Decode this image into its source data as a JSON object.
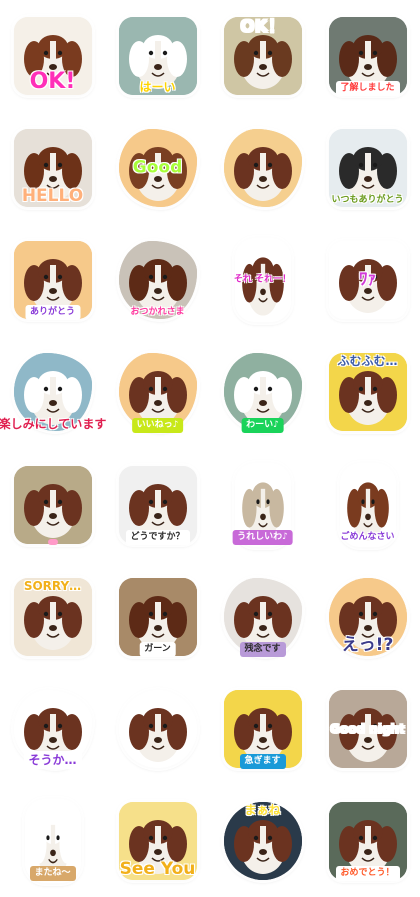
{
  "stickers": [
    {
      "id": "ok-1",
      "caption": "OK!",
      "bg": "#f5f0e8",
      "fur": "#7a3b1f",
      "text_color": "#ff2fb8",
      "label_bg": "",
      "size": "xl",
      "pos": "bottom",
      "shape": "box"
    },
    {
      "id": "ha-i",
      "caption": "はーい",
      "bg": "#9ab7b0",
      "fur": "#ffffff",
      "text_color": "#ffd400",
      "label_bg": "",
      "size": "m",
      "pos": "bottom",
      "shape": "box"
    },
    {
      "id": "ok-2",
      "caption": "OK！",
      "bg": "#cfc6a4",
      "fur": "#6a3a20",
      "text_color": "#ffffff",
      "label_bg": "",
      "size": "l",
      "pos": "top",
      "shape": "box"
    },
    {
      "id": "ryoukai",
      "caption": "了解しました",
      "bg": "#6f7a72",
      "fur": "#5a2a18",
      "text_color": "#ff3a3a",
      "label_bg": "#ffffff",
      "size": "s",
      "pos": "bottom",
      "shape": "box"
    },
    {
      "id": "hello",
      "caption": "HELLO",
      "bg": "#e6e0d8",
      "fur": "#6d3218",
      "text_color": "#ffb07a",
      "label_bg": "",
      "size": "l",
      "pos": "bottom",
      "shape": "box"
    },
    {
      "id": "good",
      "caption": "Good",
      "bg": "#f6c98a",
      "fur": "#7a3f22",
      "text_color": "#a8ff3a",
      "label_bg": "",
      "size": "l",
      "pos": "mid",
      "shape": "blob"
    },
    {
      "id": "dogs-pair",
      "caption": "",
      "bg": "#f5cf8f",
      "fur": "#6b3320",
      "text_color": "#000000",
      "label_bg": "",
      "size": "m",
      "pos": "bottom",
      "shape": "blob"
    },
    {
      "id": "itsumo-arigatou",
      "caption": "いつもありがとう",
      "bg": "#e6ecef",
      "fur": "#2a2a2a",
      "text_color": "#6a9a1a",
      "label_bg": "",
      "size": "s",
      "pos": "bottom",
      "shape": "box"
    },
    {
      "id": "arigatou",
      "caption": "ありがとう",
      "bg": "#f6c98a",
      "fur": "#6b3320",
      "text_color": "#8a3bd8",
      "label_bg": "#ffffff",
      "size": "s",
      "pos": "bottom",
      "shape": "box"
    },
    {
      "id": "otsukaresama",
      "caption": "おつかれさま",
      "bg": "#c9c2b8",
      "fur": "#5d2a16",
      "text_color": "#ff3aa0",
      "label_bg": "",
      "size": "s",
      "pos": "bottom",
      "shape": "blob"
    },
    {
      "id": "sore-sore",
      "caption": "それ それー！",
      "bg": "#ffffff",
      "fur": "#6b3320",
      "text_color": "#e026c8",
      "label_bg": "",
      "size": "s",
      "pos": "mid",
      "shape": "tall"
    },
    {
      "id": "waa",
      "caption": "ﾜｧ",
      "bg": "#ffffff",
      "fur": "#6b3320",
      "text_color": "#d23bd8",
      "label_bg": "",
      "size": "l",
      "pos": "mid",
      "shape": "box"
    },
    {
      "id": "tanoshimi",
      "caption": "楽しみにしています",
      "bg": "#8fb8c8",
      "fur": "#ffffff",
      "text_color": "#e02050",
      "label_bg": "",
      "size": "m",
      "pos": "bottom",
      "shape": "blob"
    },
    {
      "id": "iine",
      "caption": "いいねっ♪",
      "bg": "#f6c98a",
      "fur": "#6b3320",
      "text_color": "#ffffff",
      "label_bg": "#c8e81a",
      "size": "s",
      "pos": "bottom",
      "shape": "blob"
    },
    {
      "id": "waai",
      "caption": "わーい♪",
      "bg": "#8fb0a0",
      "fur": "#ffffff",
      "text_color": "#ffffff",
      "label_bg": "#1ad35a",
      "size": "s",
      "pos": "bottom",
      "shape": "blob"
    },
    {
      "id": "fumufumu",
      "caption": "ふむふむ…",
      "bg": "#f3d64a",
      "fur": "#6b3320",
      "text_color": "#3a5aa8",
      "label_bg": "",
      "size": "m",
      "pos": "top",
      "shape": "box"
    },
    {
      "id": "blank-1",
      "caption": "",
      "bg": "#b8aa88",
      "fur": "#6b3320",
      "text_color": "#ffffff",
      "label_bg": "#ff9ac8",
      "size": "s",
      "pos": "bottom",
      "shape": "box"
    },
    {
      "id": "dousuka",
      "caption": "どうですか？",
      "bg": "#f0f0f0",
      "fur": "#6b3320",
      "text_color": "#2a2a2a",
      "label_bg": "#ffffff",
      "size": "s",
      "pos": "bottom",
      "shape": "box"
    },
    {
      "id": "ureshii",
      "caption": "うれしいわ♪",
      "bg": "#ffffff",
      "fur": "#c8b8a0",
      "text_color": "#ffffff",
      "label_bg": "#c86ad8",
      "size": "s",
      "pos": "bottom",
      "shape": "tall"
    },
    {
      "id": "gomennasai",
      "caption": "ごめんなさい",
      "bg": "#ffffff",
      "fur": "#7a3b1f",
      "text_color": "#8a3bd8",
      "label_bg": "",
      "size": "s",
      "pos": "bottom",
      "shape": "tall"
    },
    {
      "id": "sorry",
      "caption": "SORRY…",
      "bg": "#f0e6d6",
      "fur": "#6b3320",
      "text_color": "#f2b01a",
      "label_bg": "",
      "size": "m",
      "pos": "top",
      "shape": "box"
    },
    {
      "id": "gaan",
      "caption": "ガーン",
      "bg": "#a88a68",
      "fur": "#5d2a16",
      "text_color": "#2a2a2a",
      "label_bg": "#ffffff",
      "size": "s",
      "pos": "bottom",
      "shape": "box"
    },
    {
      "id": "zannen",
      "caption": "残念です",
      "bg": "#e6e2de",
      "fur": "#6b3320",
      "text_color": "#2a2a2a",
      "label_bg": "#b89ad8",
      "size": "s",
      "pos": "bottom",
      "shape": "blob"
    },
    {
      "id": "ette",
      "caption": "えっ!?",
      "bg": "#f6c98a",
      "fur": "#6b3320",
      "text_color": "#3a3a8a",
      "label_bg": "",
      "size": "l",
      "pos": "bottom",
      "shape": "round"
    },
    {
      "id": "souka",
      "caption": "そうか…",
      "bg": "#ffffff",
      "fur": "#6b3320",
      "text_color": "#8a3bd8",
      "label_bg": "#ffffff",
      "size": "m",
      "pos": "bottom",
      "shape": "blob"
    },
    {
      "id": "snowman",
      "caption": "",
      "bg": "#ffffff",
      "fur": "#6b3320",
      "text_color": "#2a2a2a",
      "label_bg": "",
      "size": "s",
      "pos": "bottom",
      "shape": "round"
    },
    {
      "id": "isogimasu",
      "caption": "急ぎます",
      "bg": "#f3d64a",
      "fur": "#6b3320",
      "text_color": "#ffffff",
      "label_bg": "#1a9ad8",
      "size": "s",
      "pos": "bottom",
      "shape": "box"
    },
    {
      "id": "goodnight",
      "caption": "Good night",
      "bg": "#b8a898",
      "fur": "#6b3320",
      "text_color": "#ffffff",
      "label_bg": "",
      "size": "m",
      "pos": "mid",
      "shape": "box"
    },
    {
      "id": "matane",
      "caption": "またね～",
      "bg": "#ffffff",
      "fur": "#ffffff",
      "text_color": "#ffffff",
      "label_bg": "#d8a86a",
      "size": "s",
      "pos": "bottom",
      "shape": "tall"
    },
    {
      "id": "see-you",
      "caption": "See You",
      "bg": "#f6e08a",
      "fur": "#6b3320",
      "text_color": "#f2b01a",
      "label_bg": "",
      "size": "l",
      "pos": "bottom",
      "shape": "box"
    },
    {
      "id": "maane",
      "caption": "まぁね",
      "bg": "#2a3a4a",
      "fur": "#6b3320",
      "text_color": "#ffe23a",
      "label_bg": "",
      "size": "m",
      "pos": "top",
      "shape": "round"
    },
    {
      "id": "omedetou",
      "caption": "おめでとう！",
      "bg": "#5a6a5a",
      "fur": "#6b3320",
      "text_color": "#ff5a2a",
      "label_bg": "#ffffff",
      "size": "s",
      "pos": "bottom",
      "shape": "box"
    }
  ]
}
